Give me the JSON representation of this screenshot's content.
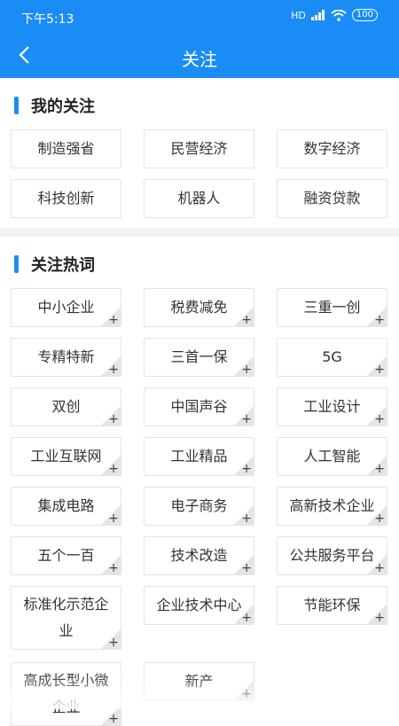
{
  "status": {
    "time": "下午5:13",
    "signal": "HD",
    "battery": "100"
  },
  "header": {
    "title": "关注"
  },
  "my_follow": {
    "title": "我的关注",
    "items": [
      "制造强省",
      "民营经济",
      "数字经济",
      "科技创新",
      "机器人",
      "融资贷款"
    ]
  },
  "hot_words": {
    "title": "关注热词",
    "items": [
      "中小企业",
      "税费减免",
      "三重一创",
      "专精特新",
      "三首一保",
      "5G",
      "双创",
      "中国声谷",
      "工业设计",
      "工业互联网",
      "工业精品",
      "人工智能",
      "集成电路",
      "电子商务",
      "高新技术企业",
      "五个一百",
      "技术改造",
      "公共服务平台",
      "标准化示范企业",
      "企业技术中心",
      "节能环保",
      "高成长型小微企业",
      "新产"
    ],
    "plus": "+"
  },
  "colors": {
    "primary": "#1a8cf5",
    "tag_border": "#e4e4e4",
    "divider": "#f0f1f3"
  }
}
